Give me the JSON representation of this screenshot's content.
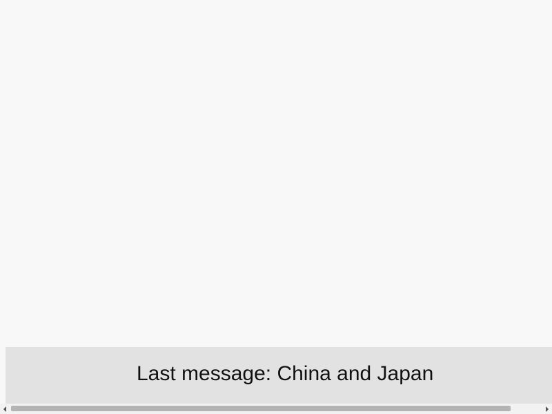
{
  "status": {
    "message": "Last message: China and Japan"
  },
  "scrollbar": {
    "left_icon": "arrow-left-icon",
    "right_icon": "arrow-right-icon",
    "thumb_fraction": 0.94
  },
  "colors": {
    "background": "#f8f8f8",
    "status_bar": "#e2e2e2",
    "scroll_thumb": "#b4b4b4"
  }
}
